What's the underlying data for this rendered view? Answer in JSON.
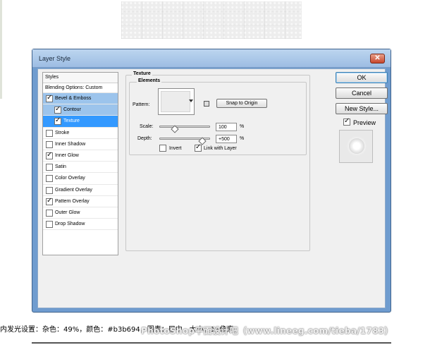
{
  "dialog": {
    "title": "Layer Style",
    "close_glyph": "✕"
  },
  "styles_panel": {
    "header": "Styles",
    "blending_options": "Blending Options: Custom",
    "items": [
      {
        "label": "Bevel & Emboss",
        "checked": true,
        "state": "sub-selected"
      },
      {
        "label": "Contour",
        "checked": true,
        "state": "sub-selected"
      },
      {
        "label": "Texture",
        "checked": true,
        "state": "selected"
      },
      {
        "label": "Stroke",
        "checked": false
      },
      {
        "label": "Inner Shadow",
        "checked": false
      },
      {
        "label": "Inner Glow",
        "checked": true
      },
      {
        "label": "Satin",
        "checked": false
      },
      {
        "label": "Color Overlay",
        "checked": false
      },
      {
        "label": "Gradient Overlay",
        "checked": false
      },
      {
        "label": "Pattern Overlay",
        "checked": true
      },
      {
        "label": "Outer Glow",
        "checked": false
      },
      {
        "label": "Drop Shadow",
        "checked": false
      }
    ]
  },
  "texture": {
    "group_title": "Texture",
    "elements_title": "Elements",
    "pattern_label": "Pattern:",
    "snap_button": "Snap to Origin",
    "scale_label": "Scale:",
    "scale_value": "100",
    "scale_unit": "%",
    "scale_level_percent": 30,
    "depth_label": "Depth:",
    "depth_value": "+500",
    "depth_unit": "%",
    "depth_level_percent": 85,
    "invert_label": "Invert",
    "invert_checked": false,
    "link_label": "Link with Layer",
    "link_checked": true
  },
  "buttons": {
    "ok": "OK",
    "cancel": "Cancel",
    "new_style": "New Style...",
    "preview_label": "Preview",
    "preview_checked": true
  },
  "caption": "内发光设置：杂色：49%，颜色：#b3b694，图素：居中，大小：18像素。",
  "watermark": "PhotoShop平面设计吧（www.lineeg.com/tieba/1783）",
  "colors": {
    "titlebar": "#a8c6e8",
    "selected_row": "#3399ff",
    "sub_selected_row": "#9cc4ec"
  }
}
